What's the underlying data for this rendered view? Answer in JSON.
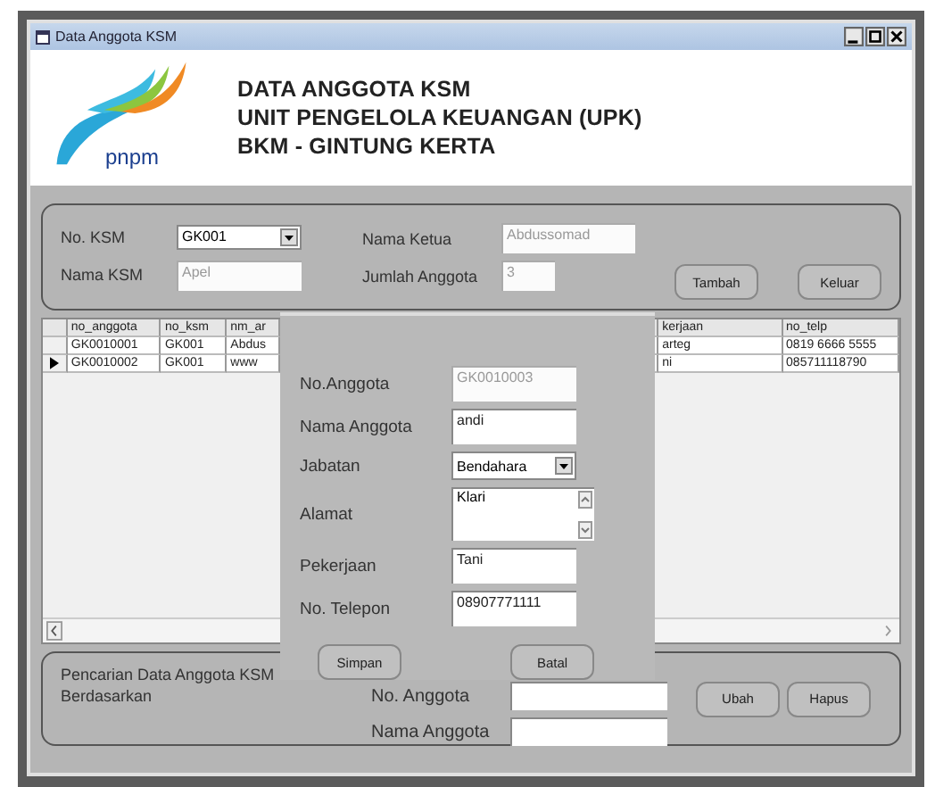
{
  "window": {
    "title": "Data Anggota KSM"
  },
  "header": {
    "logo_text": "pnpm",
    "lines": [
      "DATA ANGGOTA KSM",
      "UNIT PENGELOLA KEUANGAN (UPK)",
      "BKM - GINTUNG KERTA"
    ]
  },
  "ksm_group": {
    "no_ksm": {
      "label": "No. KSM",
      "value": "GK001"
    },
    "nama_ksm": {
      "label": "Nama KSM",
      "value": "Apel",
      "disabled": true
    },
    "nama_ketua": {
      "label": "Nama Ketua",
      "value": "Abdussomad",
      "disabled": true
    },
    "jumlah_anggota": {
      "label": "Jumlah Anggota",
      "value": "3",
      "disabled": true
    },
    "buttons": [
      "Tambah",
      "Keluar"
    ]
  },
  "table": {
    "columns": [
      "no_anggota",
      "no_ksm",
      "nm_ar",
      "",
      "kerjaan",
      "no_telp"
    ],
    "rows": [
      {
        "selected": false,
        "cells": [
          "GK0010001",
          "GK001",
          "Abdus",
          "",
          "arteg",
          "0819 6666 5555"
        ]
      },
      {
        "selected": true,
        "cells": [
          "GK0010002",
          "GK001",
          "www",
          "",
          "ni",
          "085711118790"
        ]
      }
    ]
  },
  "dialog": {
    "fields": [
      {
        "kind": "text",
        "label": "No.Anggota",
        "value": "GK0010003",
        "disabled": true
      },
      {
        "kind": "text",
        "label": "Nama Anggota",
        "value": "andi",
        "disabled": false
      },
      {
        "kind": "select",
        "label": "Jabatan",
        "value": "Bendahara"
      },
      {
        "kind": "textarea",
        "label": "Alamat",
        "value": "Klari"
      },
      {
        "kind": "text",
        "label": "Pekerjaan",
        "value": "Tani",
        "disabled": false
      },
      {
        "kind": "text",
        "label": "No. Telepon",
        "value": "08907771111",
        "disabled": false
      }
    ],
    "buttons": [
      "Simpan",
      "Batal"
    ]
  },
  "search_group": {
    "title": "Pencarian Data Anggota KSM Berdasarkan",
    "fields": [
      {
        "label": "No. Anggota"
      },
      {
        "label": "Nama Anggota"
      }
    ],
    "buttons": [
      "Ubah",
      "Hapus"
    ]
  }
}
